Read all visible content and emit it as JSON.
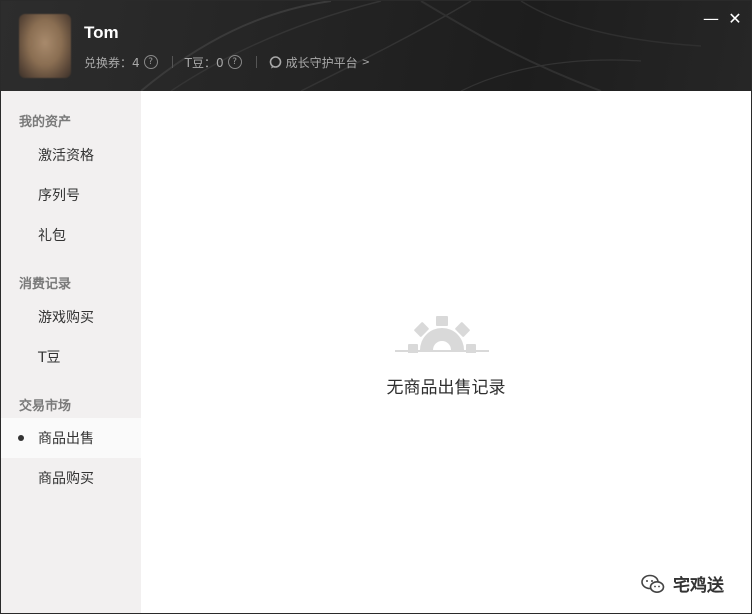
{
  "header": {
    "username": "Tom",
    "coupon_label": "兑换券：4",
    "tbean_label": "T豆：0",
    "platform_link": "成长守护平台",
    "platform_chevron": ">",
    "help_glyph": "?",
    "minimize_glyph": "—",
    "close_glyph": "✕"
  },
  "sidebar": {
    "sections": [
      {
        "title": "我的资产",
        "items": [
          "激活资格",
          "序列号",
          "礼包"
        ]
      },
      {
        "title": "消费记录",
        "items": [
          "游戏购买",
          "T豆"
        ]
      },
      {
        "title": "交易市场",
        "items": [
          "商品出售",
          "商品购买"
        ]
      }
    ],
    "active_item": "商品出售"
  },
  "main": {
    "empty_message": "无商品出售记录"
  },
  "watermark": {
    "text": "宅鸡送"
  },
  "icons": {
    "avatar": "avatar-image",
    "help": "question-circle-icon",
    "platform": "chat-bubble-icon",
    "empty": "gear-icon",
    "watermark": "wechat-icon"
  },
  "colors": {
    "header_bg": "#262626",
    "sidebar_bg": "#f2f0f0",
    "active_item_bg": "#fafafa",
    "gear_color": "#d9d9d9"
  }
}
